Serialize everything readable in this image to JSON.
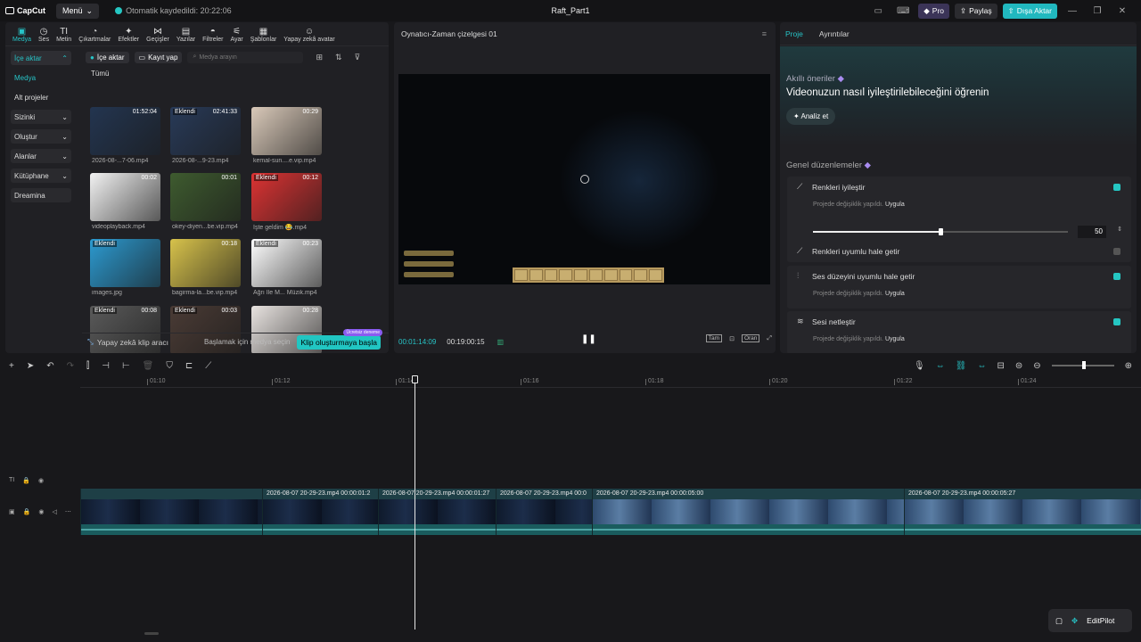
{
  "titlebar": {
    "logo": "CapCut",
    "menu": "Menü",
    "autosave": "Otomatik kaydedildi: 20:22:06",
    "project_title": "Raft_Part1",
    "pro": "Pro",
    "share": "Paylaş",
    "export": "Dışa Aktar"
  },
  "toptabs": [
    "Medya",
    "Ses",
    "Metin",
    "Çıkartmalar",
    "Efektler",
    "Geçişler",
    "Yazılar",
    "Filtreler",
    "Ayar",
    "Şablonlar",
    "Yapay zekâ avatar"
  ],
  "sidenav": [
    "İçe aktar",
    "Medya",
    "Alt projeler",
    "Sizinki",
    "Oluştur",
    "Alanlar",
    "Kütüphane",
    "Dreamina"
  ],
  "media": {
    "import": "İçe aktar",
    "record": "Kayıt yap",
    "search_placeholder": "Medya arayın",
    "all": "Tümü",
    "added_label": "Eklendi",
    "items": [
      {
        "name": "2026-08-...7-06.mp4",
        "dur": "01:52:04",
        "added": false
      },
      {
        "name": "2026-08-...9-23.mp4",
        "dur": "02:41:33",
        "added": true
      },
      {
        "name": "kemal-sun....e.vip.mp4",
        "dur": "00:29",
        "added": false
      },
      {
        "name": "videoplayback.mp4",
        "dur": "00:02",
        "added": false
      },
      {
        "name": "okey-diyen...be.vip.mp4",
        "dur": "00:01",
        "added": false
      },
      {
        "name": "İşte geldim 😂.mp4",
        "dur": "00:12",
        "added": true
      },
      {
        "name": "images.jpg",
        "dur": "",
        "added": true
      },
      {
        "name": "bagirma-la...be.vip.mp4",
        "dur": "00:18",
        "added": false
      },
      {
        "name": "Ağrı İle M... Müzik.mp4",
        "dur": "00:23",
        "added": true
      },
      {
        "name": "",
        "dur": "00:08",
        "added": true
      },
      {
        "name": "",
        "dur": "00:03",
        "added": true
      },
      {
        "name": "",
        "dur": "00:28",
        "added": false
      }
    ],
    "ai_clip": "Yapay zekâ klip aracı",
    "start_select": "Başlamak için medya seçin",
    "create_clip": "Klip oluşturmaya başla",
    "badge": "Ücretsiz deneme"
  },
  "player": {
    "title": "Oynatıcı-Zaman çizelgesi 01",
    "time_current": "00:01:14:09",
    "time_total": "00:19:00:15",
    "btn_full": "Tam",
    "btn_ratio": "Oran"
  },
  "right": {
    "tab_project": "Proje",
    "tab_details": "Ayrıntılar",
    "sugg_title": "Akıllı öneriler",
    "sugg_subtitle": "Videonuzun nasıl iyileştirilebileceğini öğrenin",
    "analyze": "Analiz et",
    "general": "Genel düzenlemeler",
    "adj1": "Renkleri iyileştir",
    "changed": "Projede değişiklik yapıldı.",
    "apply": "Uygula",
    "slider_value": "50",
    "slider_level": 0.5,
    "adj2": "Renkleri uyumlu hale getir",
    "adj3": "Ses düzeyini uyumlu hale getir",
    "adj4": "Sesi netleştir"
  },
  "ruler": [
    "01:10",
    "01:12",
    "01:14",
    "01:16",
    "01:18",
    "01:20",
    "01:22",
    "01:24"
  ],
  "clips": [
    {
      "label": ""
    },
    {
      "label": "2026-08-07 20-29-23.mp4  00:00:01:2"
    },
    {
      "label": "2026-08-07 20-29-23.mp4  00:00:01:27"
    },
    {
      "label": "2026-08-07 20-29-23.mp4  00:0"
    },
    {
      "label": "2026-08-07 20-29-23.mp4  00:00:05:00"
    },
    {
      "label": "2026-08-07 20-29-23.mp4  00:00:05:27"
    }
  ],
  "editpilot": "EditPilot",
  "colors": {
    "accent": "#21c6c2",
    "panel": "#202024",
    "bg": "#18181b"
  }
}
